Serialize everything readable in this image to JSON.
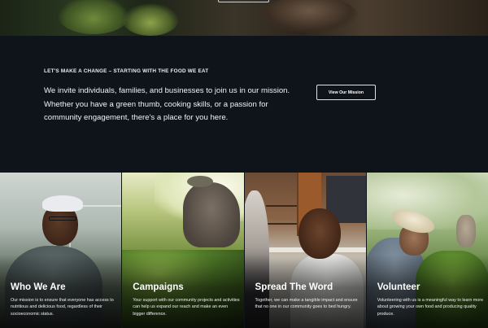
{
  "intro": {
    "eyebrow": "LET'S MAKE A CHANGE – STARTING WITH THE FOOD WE EAT",
    "lead": "We invite individuals, families, and businesses to join us in our mission. Whether you have a green thumb, cooking skills, or a passion for community engagement, there's a place for you here.",
    "cta_label": "View Our Mission"
  },
  "cards": [
    {
      "title": "Who We Are",
      "text": "Our mission is to ensure that everyone has access to nutritious and delicious food, regardless of their socioeconomic status."
    },
    {
      "title": "Campaigns",
      "text": "Your support with our community projects and activities can help us expand our reach and make an even bigger difference."
    },
    {
      "title": "Spread The Word",
      "text": "Together, we can make a tangible impact and ensure that no one in our community goes to bed hungry."
    },
    {
      "title": "Volunteer",
      "text": "Volunteering with us is a meaningful way to learn more about growing your own food and producing quality produce."
    }
  ]
}
